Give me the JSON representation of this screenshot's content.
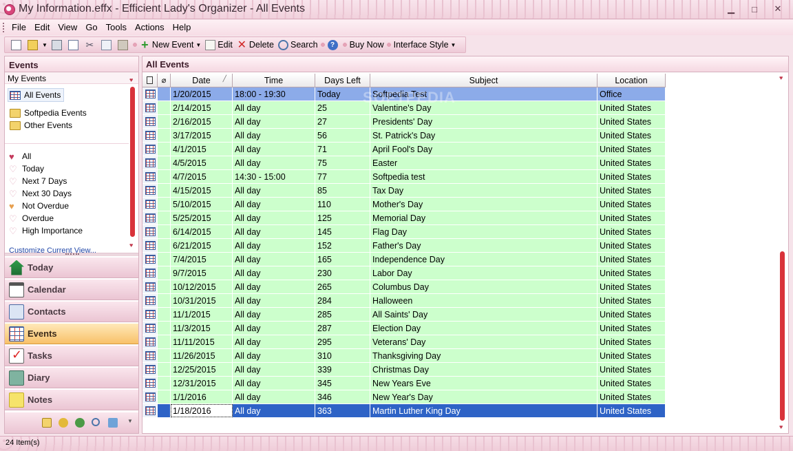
{
  "window": {
    "title": "My Information.effx - Efficient Lady's Organizer - All Events",
    "minimize": "▁",
    "maximize": "□",
    "close": "✕"
  },
  "menu": [
    "File",
    "Edit",
    "View",
    "Go",
    "Tools",
    "Actions",
    "Help"
  ],
  "toolbar": {
    "new_event": "New Event",
    "edit": "Edit",
    "delete": "Delete",
    "search": "Search",
    "buy_now": "Buy Now",
    "interface_style": "Interface Style"
  },
  "left": {
    "header": "Events",
    "section": "My Events",
    "all_events": "All Events",
    "folders": [
      "Softpedia Events",
      "Other Events"
    ],
    "filters": [
      "All",
      "Today",
      "Next 7 Days",
      "Next 30 Days",
      "Not Overdue",
      "Overdue",
      "High Importance"
    ],
    "customize": "Customize Current View...",
    "nav": [
      "Today",
      "Calendar",
      "Contacts",
      "Events",
      "Tasks",
      "Diary",
      "Notes"
    ],
    "active_nav": "Events"
  },
  "right": {
    "header": "All Events",
    "columns": [
      "Date",
      "Time",
      "Days Left",
      "Subject",
      "Location"
    ],
    "watermark": "SOFTPEDIA",
    "rows": [
      {
        "date": "1/20/2015",
        "time": "18:00 - 19:30",
        "days": "Today",
        "subject": "Softpedia Test",
        "location": "Office"
      },
      {
        "date": "2/14/2015",
        "time": "All day",
        "days": "25",
        "subject": "Valentine's Day",
        "location": "United States"
      },
      {
        "date": "2/16/2015",
        "time": "All day",
        "days": "27",
        "subject": "Presidents' Day",
        "location": "United States"
      },
      {
        "date": "3/17/2015",
        "time": "All day",
        "days": "56",
        "subject": "St. Patrick's Day",
        "location": "United States"
      },
      {
        "date": "4/1/2015",
        "time": "All day",
        "days": "71",
        "subject": "April Fool's Day",
        "location": "United States"
      },
      {
        "date": "4/5/2015",
        "time": "All day",
        "days": "75",
        "subject": "Easter",
        "location": "United States"
      },
      {
        "date": "4/7/2015",
        "time": "14:30 - 15:00",
        "days": "77",
        "subject": "Softpedia test",
        "location": "United States"
      },
      {
        "date": "4/15/2015",
        "time": "All day",
        "days": "85",
        "subject": "Tax Day",
        "location": "United States"
      },
      {
        "date": "5/10/2015",
        "time": "All day",
        "days": "110",
        "subject": "Mother's Day",
        "location": "United States"
      },
      {
        "date": "5/25/2015",
        "time": "All day",
        "days": "125",
        "subject": "Memorial Day",
        "location": "United States"
      },
      {
        "date": "6/14/2015",
        "time": "All day",
        "days": "145",
        "subject": "Flag Day",
        "location": "United States"
      },
      {
        "date": "6/21/2015",
        "time": "All day",
        "days": "152",
        "subject": "Father's Day",
        "location": "United States"
      },
      {
        "date": "7/4/2015",
        "time": "All day",
        "days": "165",
        "subject": "Independence Day",
        "location": "United States"
      },
      {
        "date": "9/7/2015",
        "time": "All day",
        "days": "230",
        "subject": "Labor Day",
        "location": "United States"
      },
      {
        "date": "10/12/2015",
        "time": "All day",
        "days": "265",
        "subject": "Columbus Day",
        "location": "United States"
      },
      {
        "date": "10/31/2015",
        "time": "All day",
        "days": "284",
        "subject": "Halloween",
        "location": "United States"
      },
      {
        "date": "11/1/2015",
        "time": "All day",
        "days": "285",
        "subject": "All Saints' Day",
        "location": "United States"
      },
      {
        "date": "11/3/2015",
        "time": "All day",
        "days": "287",
        "subject": "Election Day",
        "location": "United States"
      },
      {
        "date": "11/11/2015",
        "time": "All day",
        "days": "295",
        "subject": "Veterans' Day",
        "location": "United States"
      },
      {
        "date": "11/26/2015",
        "time": "All day",
        "days": "310",
        "subject": "Thanksgiving Day",
        "location": "United States"
      },
      {
        "date": "12/25/2015",
        "time": "All day",
        "days": "339",
        "subject": "Christmas Day",
        "location": "United States"
      },
      {
        "date": "12/31/2015",
        "time": "All day",
        "days": "345",
        "subject": "New Years Eve",
        "location": "United States"
      },
      {
        "date": "1/1/2016",
        "time": "All day",
        "days": "346",
        "subject": "New Year's Day",
        "location": "United States"
      },
      {
        "date": "1/18/2016",
        "time": "All day",
        "days": "363",
        "subject": "Martin Luther King Day",
        "location": "United States"
      }
    ]
  },
  "status": "24 Item(s)",
  "colors": {
    "row_green": "#ccffcc",
    "today_row": "#8cabe9",
    "selected_row": "#2e63c6",
    "accent_nav": "#f8c169"
  }
}
